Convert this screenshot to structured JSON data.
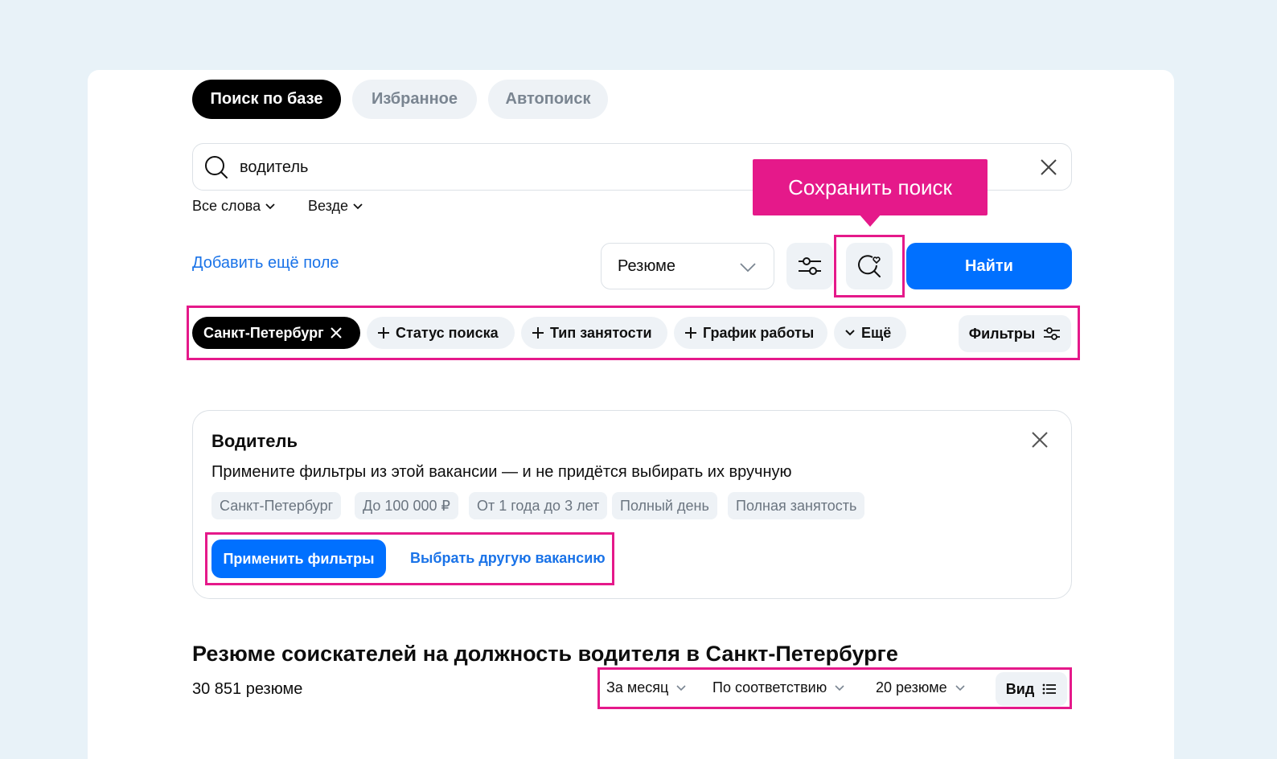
{
  "tabs": [
    {
      "label": "Поиск по базе",
      "active": true
    },
    {
      "label": "Избранное",
      "active": false
    },
    {
      "label": "Автопоиск",
      "active": false
    }
  ],
  "search": {
    "value": "водитель",
    "icon": "search-icon",
    "clear_icon": "close-icon"
  },
  "search_options": {
    "words": "Все слова",
    "where": "Везде"
  },
  "add_field": "Добавить ещё поле",
  "type_select": {
    "value": "Резюме"
  },
  "save_search_tooltip": "Сохранить поиск",
  "find_button": "Найти",
  "chips": {
    "city": "Санкт-Петербург",
    "status": "Статус поиска",
    "employment": "Тип занятости",
    "schedule": "График работы",
    "more": "Ещё"
  },
  "filters_button": "Фильтры",
  "vacancy_card": {
    "title": "Водитель",
    "description": "Примените фильтры из этой вакансии — и не придётся выбирать их вручную",
    "tags": [
      "Санкт-Петербург",
      "До 100 000 ₽",
      "От 1 года до 3 лет",
      "Полный день",
      "Полная занятость"
    ],
    "apply_button": "Применить фильтры",
    "choose_other": "Выбрать другую вакансию"
  },
  "results": {
    "heading": "Резюме соискателей на должность водителя в Санкт-Петербурге",
    "count": "30 851 резюме",
    "period": "За месяц",
    "sort": "По соответствию",
    "per_page": "20 резюме",
    "view": "Вид"
  },
  "colors": {
    "accent": "#0070ff",
    "highlight": "#e5198a",
    "link": "#1a73e8"
  }
}
